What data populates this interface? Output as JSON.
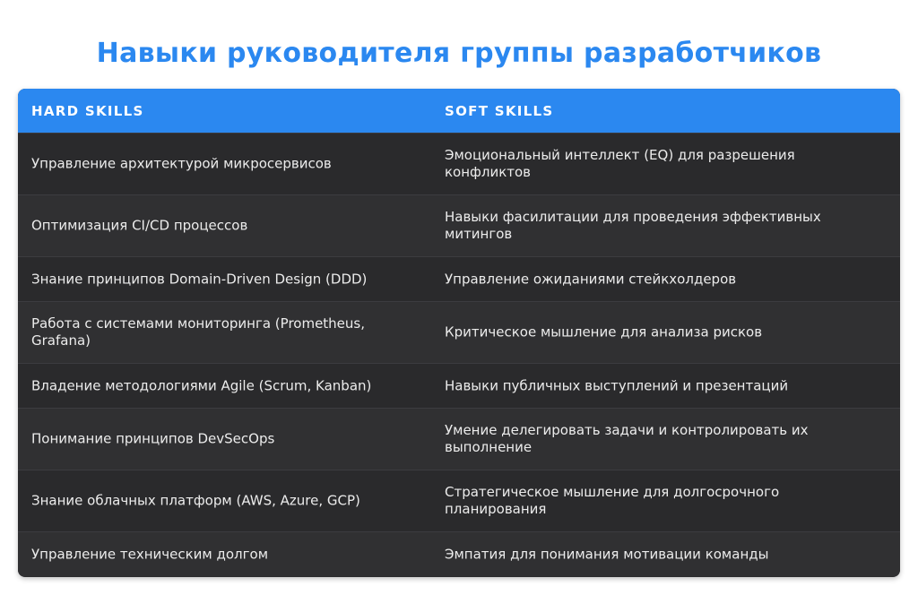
{
  "title": "Навыки руководителя группы разработчиков",
  "table": {
    "headers": [
      "HARD SKILLS",
      "SOFT SKILLS"
    ],
    "rows": [
      {
        "hard": "Управление архитектурой микросервисов",
        "soft": "Эмоциональный интеллект (EQ) для разрешения конфликтов"
      },
      {
        "hard": "Оптимизация CI/CD процессов",
        "soft": "Навыки фасилитации для проведения эффективных митингов"
      },
      {
        "hard": "Знание принципов Domain-Driven Design (DDD)",
        "soft": "Управление ожиданиями стейкхолдеров"
      },
      {
        "hard": "Работа с системами мониторинга (Prometheus, Grafana)",
        "soft": "Критическое мышление для анализа рисков"
      },
      {
        "hard": "Владение методологиями Agile (Scrum, Kanban)",
        "soft": "Навыки публичных выступлений и презентаций"
      },
      {
        "hard": "Понимание принципов DevSecOps",
        "soft": "Умение делегировать задачи и контролировать их выполнение"
      },
      {
        "hard": "Знание облачных платформ (AWS, Azure, GCP)",
        "soft": "Стратегическое мышление для долгосрочного планирования"
      },
      {
        "hard": "Управление техническим долгом",
        "soft": "Эмпатия для понимания мотивации команды"
      }
    ]
  },
  "colors": {
    "accent": "#2b88f0",
    "table_background": "#2c2c2e",
    "text": "#ececec"
  }
}
